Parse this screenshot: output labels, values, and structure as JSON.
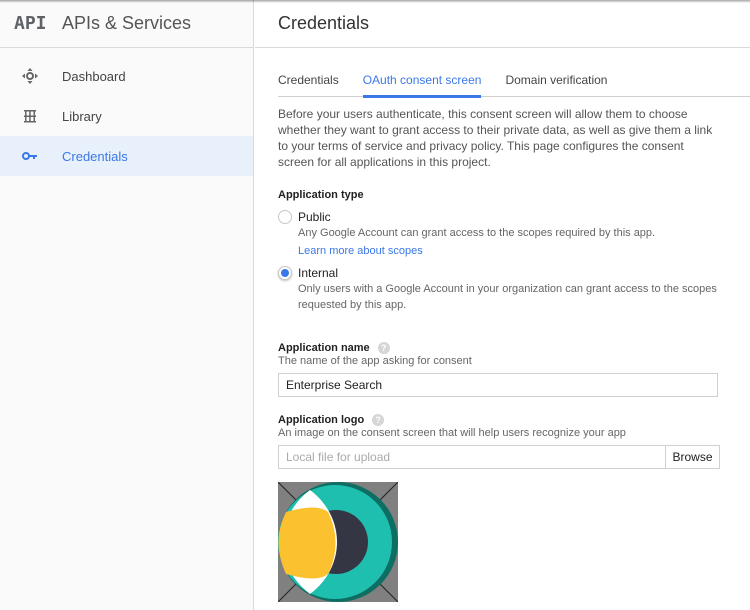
{
  "sidebar": {
    "logo_text": "API",
    "title": "APIs & Services",
    "items": [
      {
        "label": "Dashboard",
        "icon": "dashboard-icon",
        "active": false
      },
      {
        "label": "Library",
        "icon": "library-icon",
        "active": false
      },
      {
        "label": "Credentials",
        "icon": "key-icon",
        "active": true
      }
    ]
  },
  "header": {
    "title": "Credentials"
  },
  "tabs": [
    {
      "label": "Credentials",
      "active": false
    },
    {
      "label": "OAuth consent screen",
      "active": true
    },
    {
      "label": "Domain verification",
      "active": false
    }
  ],
  "intro": "Before your users authenticate, this consent screen will allow them to choose whether they want to grant access to their private data, as well as give them a link to your terms of service and privacy policy. This page configures the consent screen for all applications in this project.",
  "application_type": {
    "label": "Application type",
    "options": [
      {
        "label": "Public",
        "description": "Any Google Account can grant access to the scopes required by this app.",
        "link": "Learn more about scopes",
        "selected": false
      },
      {
        "label": "Internal",
        "description": "Only users with a Google Account in your organization can grant access to the scopes requested by this app.",
        "selected": true
      }
    ]
  },
  "application_name": {
    "label": "Application name",
    "description": "The name of the app asking for consent",
    "value": "Enterprise Search",
    "help_icon": "?"
  },
  "application_logo": {
    "label": "Application logo",
    "description": "An image on the consent screen that will help users recognize your app",
    "placeholder": "Local file for upload",
    "browse_label": "Browse",
    "help_icon": "?"
  },
  "colors": {
    "accent": "#3b78e7",
    "logo_teal": "#1fbfaf",
    "logo_teal_dark": "#0e6e63",
    "logo_yellow": "#fcc12e",
    "logo_navy": "#343643",
    "logo_bg": "#808080"
  }
}
